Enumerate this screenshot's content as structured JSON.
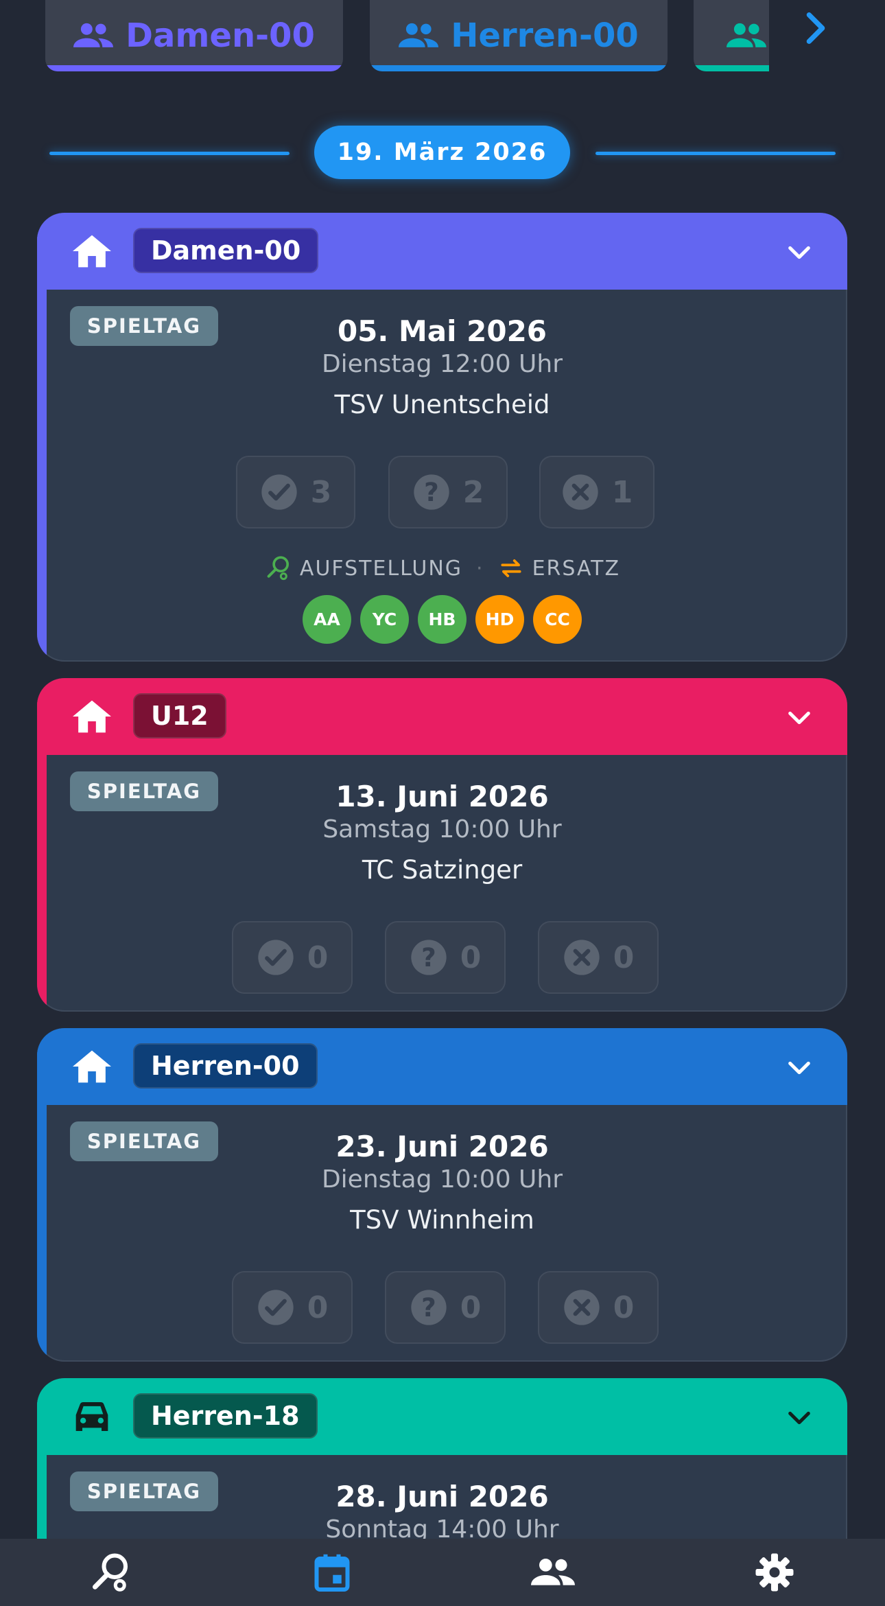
{
  "tabs": [
    {
      "label": "Damen-00",
      "color": "#6c63ff",
      "icon": "people-icon"
    },
    {
      "label": "Herren-00",
      "color": "#1e88e5",
      "icon": "people-icon"
    },
    {
      "label": "",
      "color": "#00bfa5",
      "icon": "people-icon"
    }
  ],
  "date_divider": {
    "label": "19. März 2026"
  },
  "cards": [
    {
      "team": "Damen-00",
      "type_label": "SPIELTAG",
      "date": "05. Mai 2026",
      "time": "Dienstag 12:00 Uhr",
      "opponent": "TSV Unentscheid",
      "location_icon": "home-icon",
      "color": "#6366f1",
      "badge_color": "#3730a3",
      "votes": {
        "yes": "3",
        "maybe": "2",
        "no": "1"
      },
      "lineup_label": "AUFSTELLUNG",
      "substitute_label": "ERSATZ",
      "avatars": [
        {
          "initials": "AA",
          "color": "#4caf50"
        },
        {
          "initials": "YC",
          "color": "#4caf50"
        },
        {
          "initials": "HB",
          "color": "#4caf50"
        },
        {
          "initials": "HD",
          "color": "#ff9800"
        },
        {
          "initials": "CC",
          "color": "#ff9800"
        }
      ]
    },
    {
      "team": "U12",
      "type_label": "SPIELTAG",
      "date": "13. Juni 2026",
      "time": "Samstag 10:00 Uhr",
      "opponent": "TC Satzinger",
      "location_icon": "home-icon",
      "color": "#e91e63",
      "badge_color": "#7b1134",
      "votes": {
        "yes": "0",
        "maybe": "0",
        "no": "0"
      }
    },
    {
      "team": "Herren-00",
      "type_label": "SPIELTAG",
      "date": "23. Juni 2026",
      "time": "Dienstag 10:00 Uhr",
      "opponent": "TSV Winnheim",
      "location_icon": "home-icon",
      "color": "#1e74d2",
      "badge_color": "#0d3f78",
      "votes": {
        "yes": "0",
        "maybe": "0",
        "no": "0"
      }
    },
    {
      "team": "Herren-18",
      "type_label": "SPIELTAG",
      "date": "28. Juni 2026",
      "time": "Sonntag 14:00 Uhr",
      "location_icon": "car-icon",
      "color": "#00bfa5",
      "badge_color": "#05594e"
    }
  ],
  "nav": [
    {
      "icon": "tennis-racket-icon",
      "active": false
    },
    {
      "icon": "calendar-icon",
      "active": true
    },
    {
      "icon": "people-icon",
      "active": false
    },
    {
      "icon": "gear-icon",
      "active": false
    }
  ]
}
